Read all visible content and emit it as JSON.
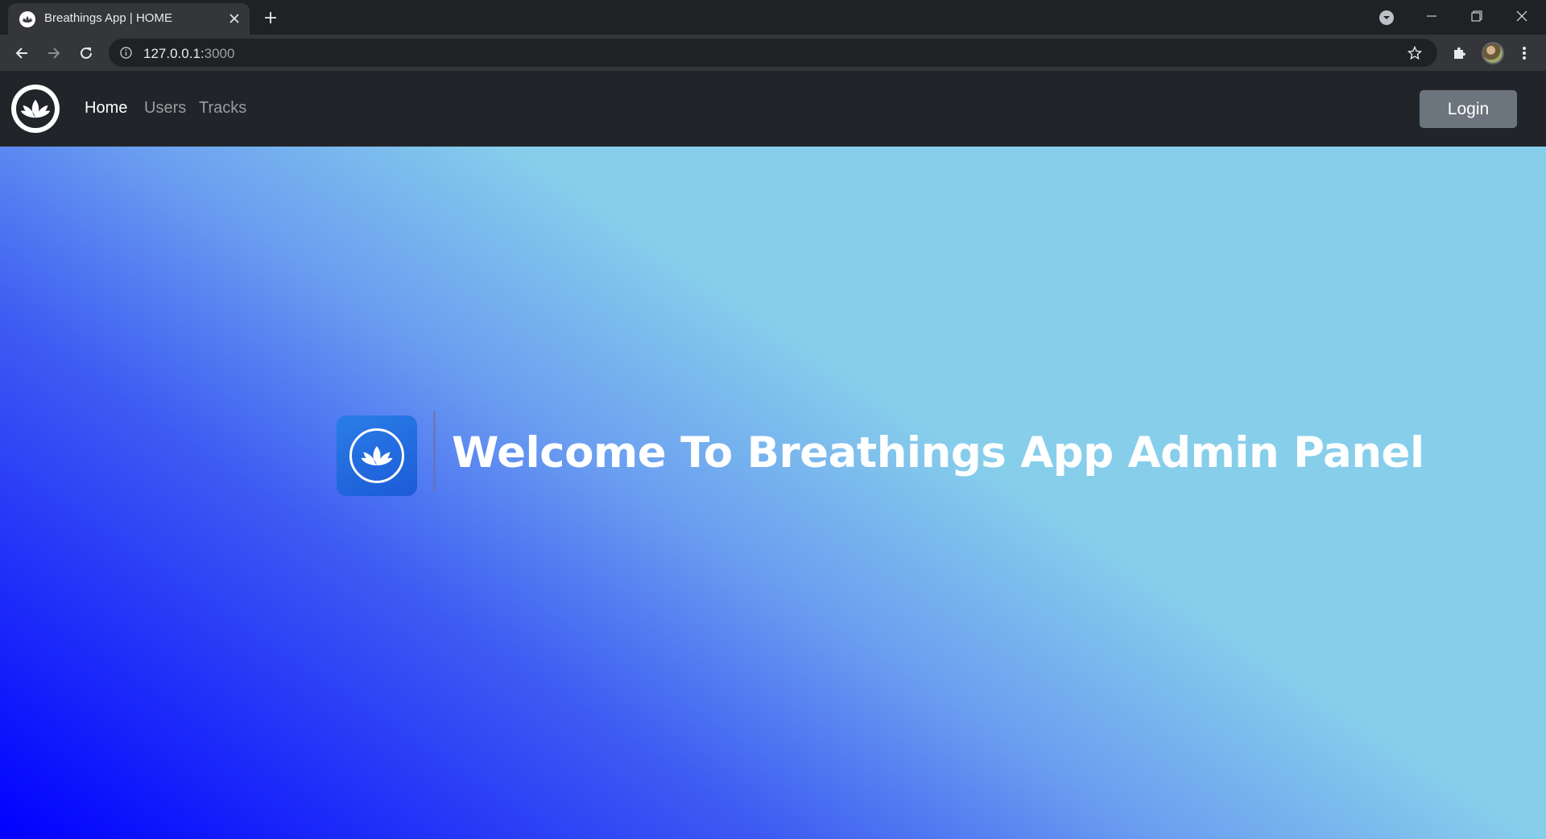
{
  "browser": {
    "tab_title": "Breathings App | HOME",
    "url_host": "127.0.0.1:",
    "url_port": "3000"
  },
  "navbar": {
    "links": [
      {
        "label": "Home",
        "active": true
      },
      {
        "label": "Users",
        "active": false
      },
      {
        "label": "Tracks",
        "active": false
      }
    ],
    "login_label": "Login"
  },
  "hero": {
    "title": "Welcome To Breathings App Admin Panel",
    "gradient_colors": [
      "#0000ff",
      "#87ceeb"
    ]
  },
  "colors": {
    "navbar_bg": "#212529",
    "login_button": "#6c757d",
    "app_icon": "#1c5bd6"
  },
  "icons": [
    "lotus-icon",
    "close-icon",
    "plus-icon",
    "tab-search-icon",
    "minimize-icon",
    "maximize-icon",
    "back-arrow-icon",
    "forward-arrow-icon",
    "reload-icon",
    "info-icon",
    "star-icon",
    "puzzle-icon",
    "kebab-menu-icon"
  ]
}
